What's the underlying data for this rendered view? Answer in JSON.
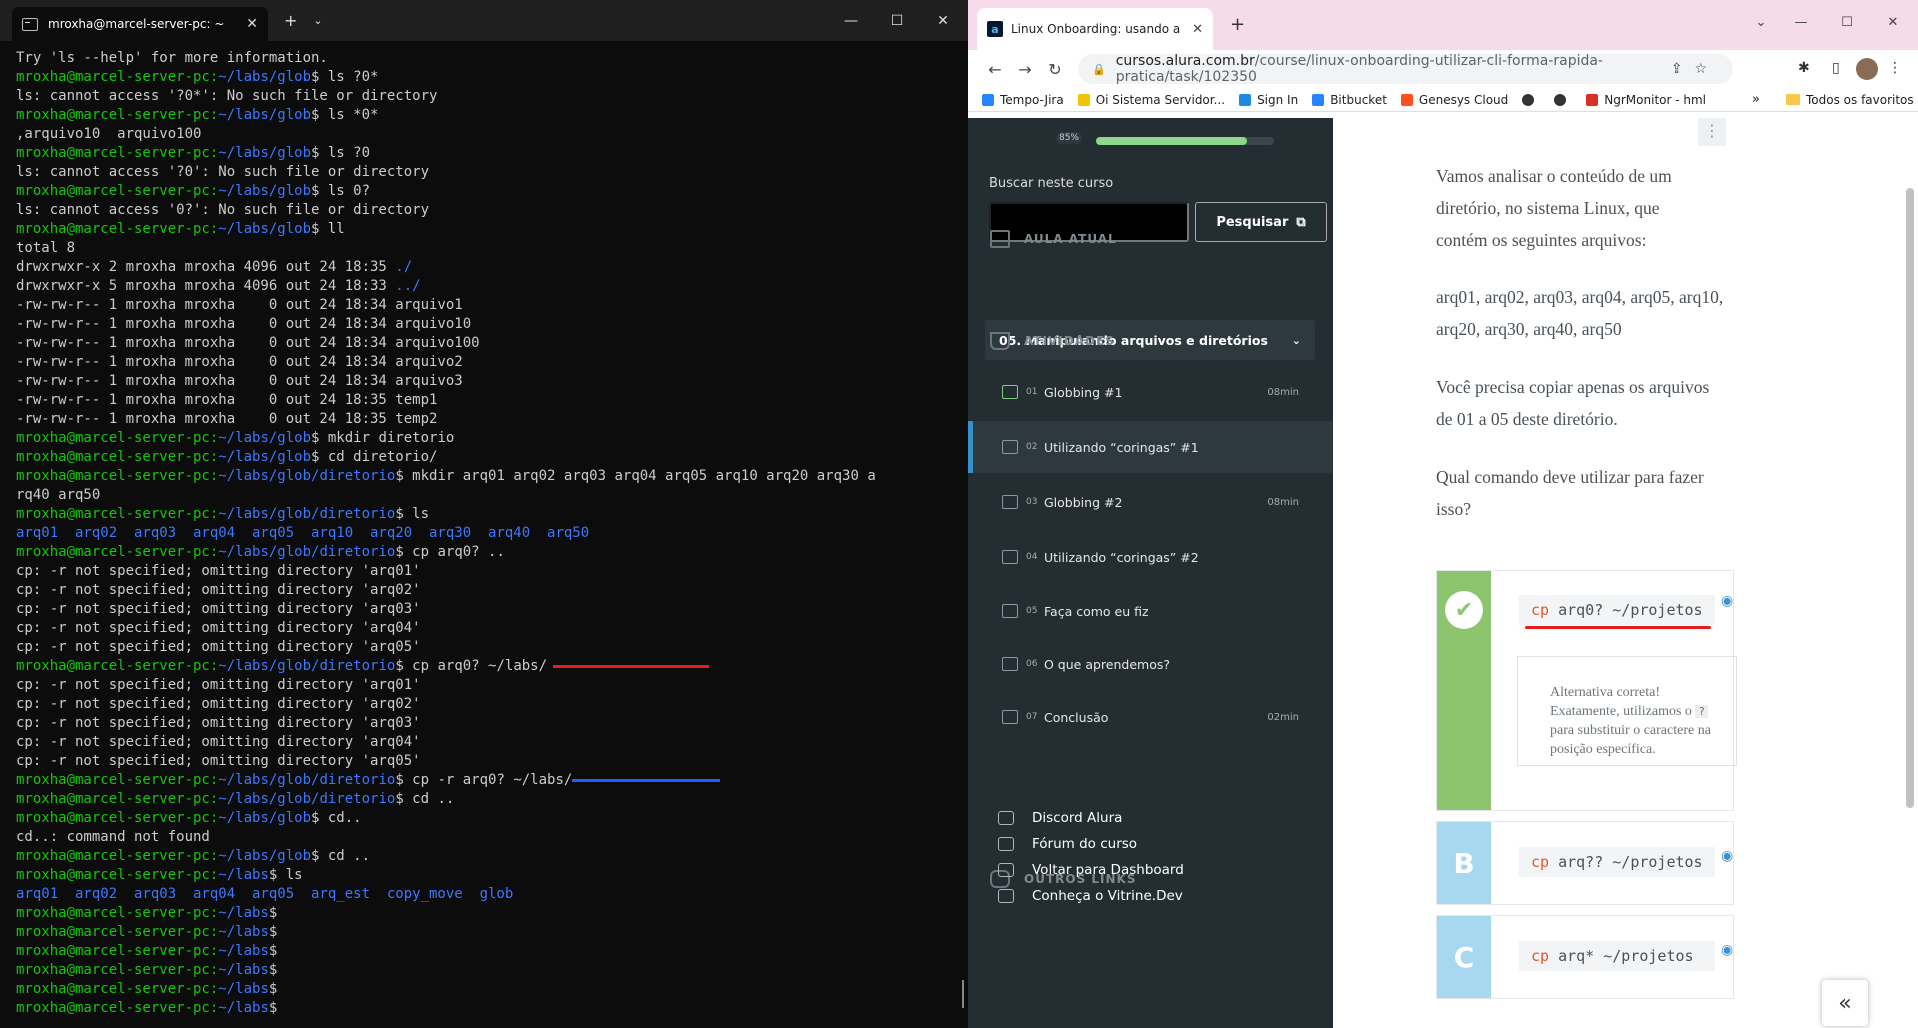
{
  "terminal": {
    "tab_title": "mroxha@marcel-server-pc: ~",
    "prompt_user": "mroxha@marcel-server-pc",
    "lines": [
      {
        "t": "out",
        "text": "Try 'ls --help' for more information."
      },
      {
        "t": "cmd",
        "path": "~/labs/glob",
        "cmd": "ls ?0*"
      },
      {
        "t": "out",
        "text": "ls: cannot access '?0*': No such file or directory"
      },
      {
        "t": "cmd",
        "path": "~/labs/glob",
        "cmd": "ls *0*"
      },
      {
        "t": "out",
        "text": ",arquivo10  arquivo100"
      },
      {
        "t": "cmd",
        "path": "~/labs/glob",
        "cmd": "ls ?0"
      },
      {
        "t": "out",
        "text": "ls: cannot access '?0': No such file or directory"
      },
      {
        "t": "cmd",
        "path": "~/labs/glob",
        "cmd": "ls 0?"
      },
      {
        "t": "out",
        "text": "ls: cannot access '0?': No such file or directory"
      },
      {
        "t": "cmd",
        "path": "~/labs/glob",
        "cmd": "ll"
      },
      {
        "t": "out",
        "text": "total 8"
      },
      {
        "t": "out",
        "text": "drwxrwxr-x 2 mroxha mroxha 4096 out 24 18:35 ",
        "dir": "./"
      },
      {
        "t": "out",
        "text": "drwxrwxr-x 5 mroxha mroxha 4096 out 24 18:33 ",
        "dir": "../"
      },
      {
        "t": "out",
        "text": "-rw-rw-r-- 1 mroxha mroxha    0 out 24 18:34 arquivo1"
      },
      {
        "t": "out",
        "text": "-rw-rw-r-- 1 mroxha mroxha    0 out 24 18:34 arquivo10"
      },
      {
        "t": "out",
        "text": "-rw-rw-r-- 1 mroxha mroxha    0 out 24 18:34 arquivo100"
      },
      {
        "t": "out",
        "text": "-rw-rw-r-- 1 mroxha mroxha    0 out 24 18:34 arquivo2"
      },
      {
        "t": "out",
        "text": "-rw-rw-r-- 1 mroxha mroxha    0 out 24 18:34 arquivo3"
      },
      {
        "t": "out",
        "text": "-rw-rw-r-- 1 mroxha mroxha    0 out 24 18:35 temp1"
      },
      {
        "t": "out",
        "text": "-rw-rw-r-- 1 mroxha mroxha    0 out 24 18:35 temp2"
      },
      {
        "t": "cmd",
        "path": "~/labs/glob",
        "cmd": "mkdir diretorio"
      },
      {
        "t": "cmd",
        "path": "~/labs/glob",
        "cmd": "cd diretorio/"
      },
      {
        "t": "cmd",
        "path": "~/labs/glob/diretorio",
        "cmd": "mkdir arq01 arq02 arq03 arq04 arq05 arq10 arq20 arq30 a"
      },
      {
        "t": "out",
        "text": "rq40 arq50"
      },
      {
        "t": "cmd",
        "path": "~/labs/glob/diretorio",
        "cmd": "ls"
      },
      {
        "t": "dirs",
        "text": "arq01  arq02  arq03  arq04  arq05  arq10  arq20  arq30  arq40  arq50"
      },
      {
        "t": "cmd",
        "path": "~/labs/glob/diretorio",
        "cmd": "cp arq0? .."
      },
      {
        "t": "out",
        "text": "cp: -r not specified; omitting directory 'arq01'"
      },
      {
        "t": "out",
        "text": "cp: -r not specified; omitting directory 'arq02'"
      },
      {
        "t": "out",
        "text": "cp: -r not specified; omitting directory 'arq03'"
      },
      {
        "t": "out",
        "text": "cp: -r not specified; omitting directory 'arq04'"
      },
      {
        "t": "out",
        "text": "cp: -r not specified; omitting directory 'arq05'"
      },
      {
        "t": "cmd",
        "path": "~/labs/glob/diretorio",
        "cmd": "cp arq0? ~/labs/",
        "mark": "red"
      },
      {
        "t": "out",
        "text": "cp: -r not specified; omitting directory 'arq01'"
      },
      {
        "t": "out",
        "text": "cp: -r not specified; omitting directory 'arq02'"
      },
      {
        "t": "out",
        "text": "cp: -r not specified; omitting directory 'arq03'"
      },
      {
        "t": "out",
        "text": "cp: -r not specified; omitting directory 'arq04'"
      },
      {
        "t": "out",
        "text": "cp: -r not specified; omitting directory 'arq05'"
      },
      {
        "t": "cmd",
        "path": "~/labs/glob/diretorio",
        "cmd": "cp -r arq0? ~/labs/",
        "mark": "blue"
      },
      {
        "t": "cmd",
        "path": "~/labs/glob/diretorio",
        "cmd": "cd .."
      },
      {
        "t": "cmd",
        "path": "~/labs/glob",
        "cmd": "cd.."
      },
      {
        "t": "out",
        "text": "cd..: command not found"
      },
      {
        "t": "cmd",
        "path": "~/labs/glob",
        "cmd": "cd .."
      },
      {
        "t": "cmd",
        "path": "~/labs",
        "cmd": "ls"
      },
      {
        "t": "dirs",
        "text": "arq01  arq02  arq03  arq04  arq05  arq_est  copy_move  glob"
      },
      {
        "t": "cmd",
        "path": "~/labs",
        "cmd": ""
      },
      {
        "t": "cmd",
        "path": "~/labs",
        "cmd": ""
      },
      {
        "t": "cmd",
        "path": "~/labs",
        "cmd": ""
      },
      {
        "t": "cmd",
        "path": "~/labs",
        "cmd": ""
      },
      {
        "t": "cmd",
        "path": "~/labs",
        "cmd": ""
      },
      {
        "t": "cmd",
        "path": "~/labs",
        "cmd": ""
      }
    ]
  },
  "browser": {
    "tab_title": "Linux Onboarding: usando a CLI",
    "favicon_letter": "a",
    "url_domain": "cursos.alura.com.br",
    "url_path": "/course/linux-onboarding-utilizar-cli-forma-rapida-pratica/task/102350",
    "bookmarks": [
      {
        "label": "Tempo-Jira",
        "color": "#2684ff"
      },
      {
        "label": "Oi Sistema Servidor...",
        "color": "#f2c300"
      },
      {
        "label": "Sign In",
        "color": "#1e88e5"
      },
      {
        "label": "Bitbucket",
        "color": "#2684ff"
      },
      {
        "label": "Genesys Cloud",
        "color": "#ff4f1f"
      },
      {
        "label": "",
        "color": "#333"
      },
      {
        "label": "",
        "color": "#333"
      },
      {
        "label": "NgrMonitor - hml",
        "color": "#d93025"
      }
    ],
    "bookmarks_more": "»",
    "bookmarks_all": "Todos os favoritos"
  },
  "sidebar": {
    "progress_label": "85%",
    "progress_value": 0.85,
    "search_label": "Buscar neste curso",
    "search_button": "Pesquisar",
    "aula_atual_title": "AULA ATUAL",
    "aula_atual_value": "05. Manipulando arquivos e diretórios",
    "atividades_title": "ATIVIDADES",
    "activities": [
      {
        "num": "01",
        "label": "Globbing #1",
        "dur": "08min"
      },
      {
        "num": "02",
        "label": "Utilizando “coringas” #1",
        "dur": ""
      },
      {
        "num": "03",
        "label": "Globbing #2",
        "dur": "08min"
      },
      {
        "num": "04",
        "label": "Utilizando “coringas” #2",
        "dur": ""
      },
      {
        "num": "05",
        "label": "Faça como eu fiz",
        "dur": ""
      },
      {
        "num": "06",
        "label": "O que aprendemos?",
        "dur": ""
      },
      {
        "num": "07",
        "label": "Conclusão",
        "dur": "02min"
      }
    ],
    "outros_title": "OUTROS LINKS",
    "links": [
      "Discord Alura",
      "Fórum do curso",
      "Voltar para Dashboard",
      "Conheça o Vitrine.Dev"
    ]
  },
  "content": {
    "p1": "Vamos analisar o conteúdo de um diretório, no sistema Linux, que contém os seguintes arquivos:",
    "p2": "arq01, arq02, arq03, arq04, arq05, arq10, arq20, arq30, arq40, arq50",
    "p3": "Você precisa copiar apenas os arquivos de 01 a 05 deste diretório.",
    "p4": "Qual comando deve utilizar para fazer isso?",
    "alternatives": [
      {
        "letter": "",
        "cmd_kw": "cp",
        "cmd_rest": " arq0? ~/projetos",
        "color": "#8cc56e"
      },
      {
        "letter": "B",
        "cmd_kw": "cp",
        "cmd_rest": " arq?? ~/projetos",
        "color": "#a8d7f0"
      },
      {
        "letter": "C",
        "cmd_kw": "cp",
        "cmd_rest": " arq* ~/projetos",
        "color": "#a8d7f0"
      }
    ],
    "feedback_line1": "Alternativa correta!",
    "feedback_line2a": "Exatamente, utilizamos o ",
    "feedback_symbol": "?",
    "feedback_line2b": " para substituir o caractere na posição específica."
  }
}
